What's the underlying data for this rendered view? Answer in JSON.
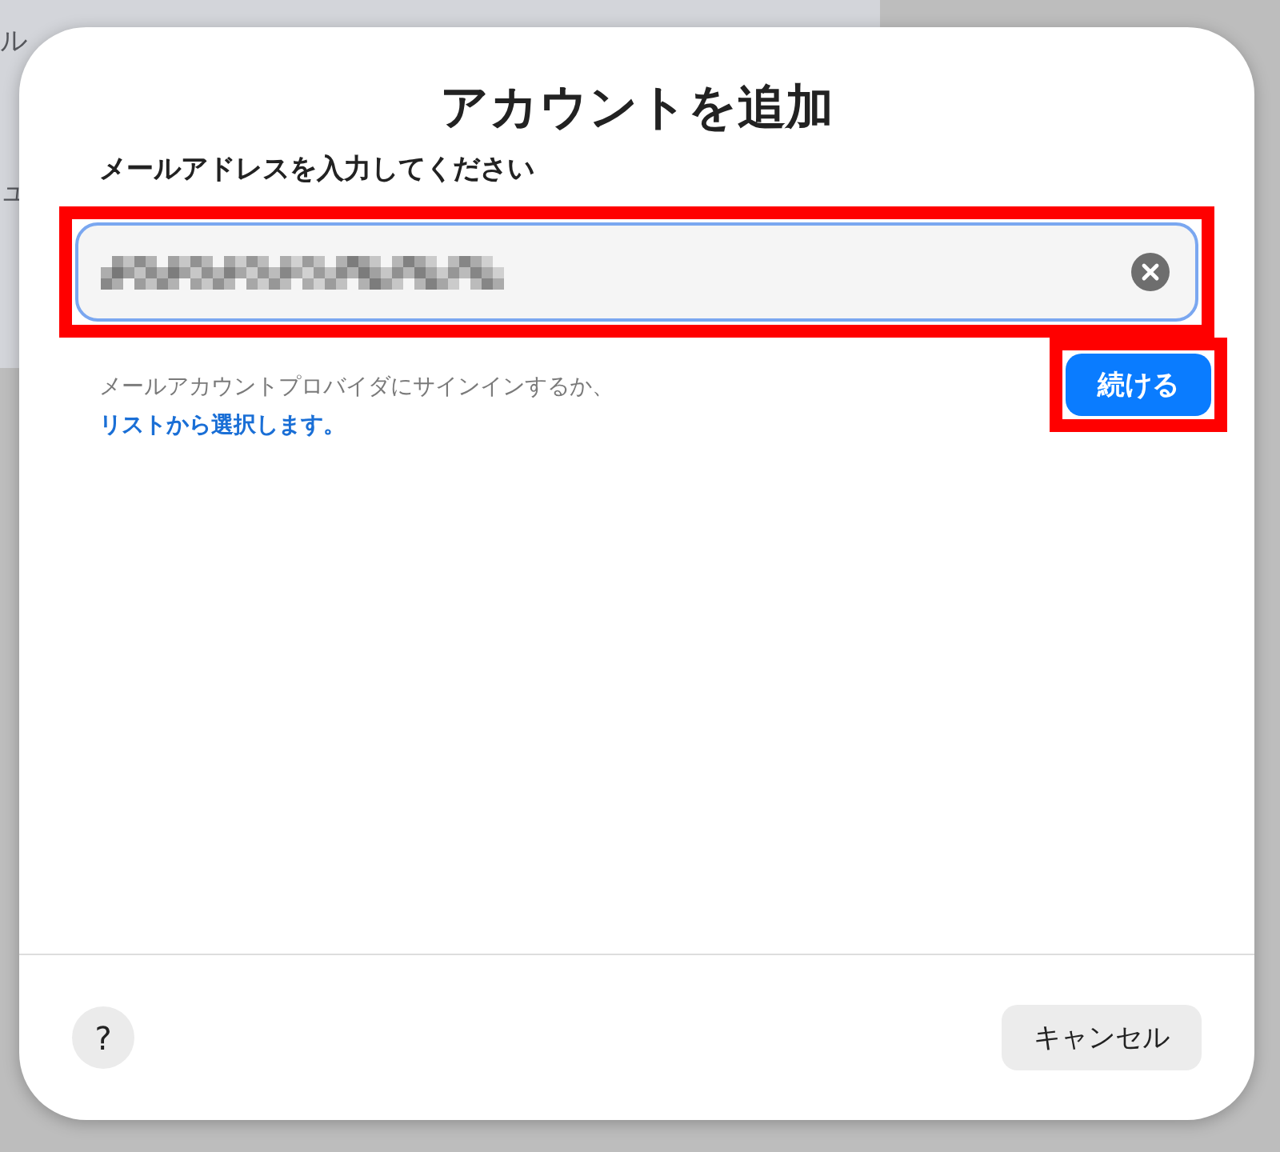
{
  "background": {
    "fragments": [
      "ル",
      "ュ"
    ]
  },
  "dialog": {
    "title": "アカウントを追加",
    "field_label": "メールアドレスを入力してください",
    "email_field": {
      "highlighted": true
    },
    "hint": "メールアカウントプロバイダにサインインするか、",
    "link": "リストから選択します。",
    "continue_button": {
      "label": "続ける",
      "highlighted": true
    },
    "help_button": "?",
    "cancel_button": "キャンセル"
  }
}
